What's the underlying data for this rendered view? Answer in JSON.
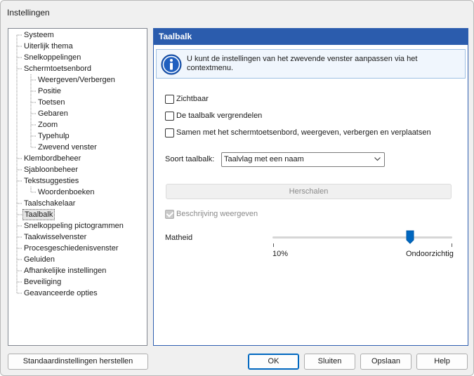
{
  "window": {
    "title": "Instellingen"
  },
  "tree": {
    "items": [
      {
        "label": "Systeem",
        "level": 0
      },
      {
        "label": "Uiterlijk thema",
        "level": 0
      },
      {
        "label": "Snelkoppelingen",
        "level": 0
      },
      {
        "label": "Schermtoetsenbord",
        "level": 0
      },
      {
        "label": "Weergeven/Verbergen",
        "level": 1
      },
      {
        "label": "Positie",
        "level": 1
      },
      {
        "label": "Toetsen",
        "level": 1
      },
      {
        "label": "Gebaren",
        "level": 1
      },
      {
        "label": "Zoom",
        "level": 1
      },
      {
        "label": "Typehulp",
        "level": 1
      },
      {
        "label": "Zwevend venster",
        "level": 1
      },
      {
        "label": "Klembordbeheer",
        "level": 0
      },
      {
        "label": "Sjabloonbeheer",
        "level": 0
      },
      {
        "label": "Tekstsuggesties",
        "level": 0
      },
      {
        "label": "Woordenboeken",
        "level": 1
      },
      {
        "label": "Taalschakelaar",
        "level": 0
      },
      {
        "label": "Taalbalk",
        "level": 0,
        "selected": true
      },
      {
        "label": "Snelkoppeling pictogrammen",
        "level": 0
      },
      {
        "label": "Taakwisselvenster",
        "level": 0
      },
      {
        "label": "Procesgeschiedenisvenster",
        "level": 0
      },
      {
        "label": "Geluiden",
        "level": 0
      },
      {
        "label": "Afhankelijke instellingen",
        "level": 0
      },
      {
        "label": "Beveiliging",
        "level": 0
      },
      {
        "label": "Geavanceerde opties",
        "level": 0
      }
    ]
  },
  "panel": {
    "header": "Taalbalk",
    "info_text": "U kunt de instellingen van het zwevende venster aanpassen via het contextmenu.",
    "checkboxes": {
      "visible": "Zichtbaar",
      "lock": "De taalbalk vergrendelen",
      "together": "Samen met het schermtoetsenbord, weergeven, verbergen en verplaatsen"
    },
    "type_label": "Soort taalbalk:",
    "type_value": "Taalvlag met een naam",
    "resize_button": "Herschalen",
    "show_description": "Beschrijving weergeven",
    "opacity_label": "Matheid",
    "opacity_min": "10%",
    "opacity_max": "Ondoorzichtig",
    "opacity_level": 1.0
  },
  "buttons": {
    "reset": "Standaardinstellingen herstellen",
    "ok": "OK",
    "close": "Sluiten",
    "save": "Opslaan",
    "help": "Help"
  },
  "colors": {
    "header_bg": "#2b5cad",
    "accent": "#0067c0"
  }
}
